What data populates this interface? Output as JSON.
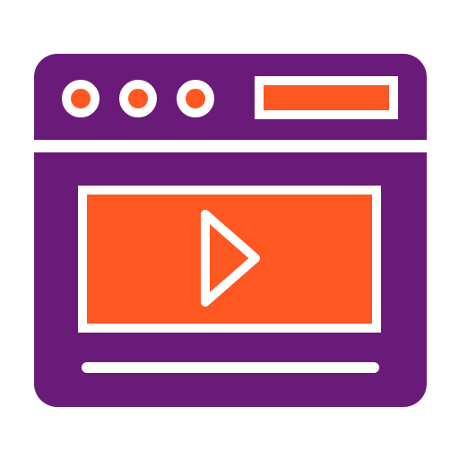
{
  "icon": {
    "name": "video-player-webpage-icon",
    "colors": {
      "frame": "#6a1b7a",
      "accent": "#ff5722",
      "line": "#ffffff",
      "background": "#ffffff"
    },
    "window_dots": [
      "dot-1",
      "dot-2",
      "dot-3"
    ],
    "play_icon": "play-icon"
  }
}
